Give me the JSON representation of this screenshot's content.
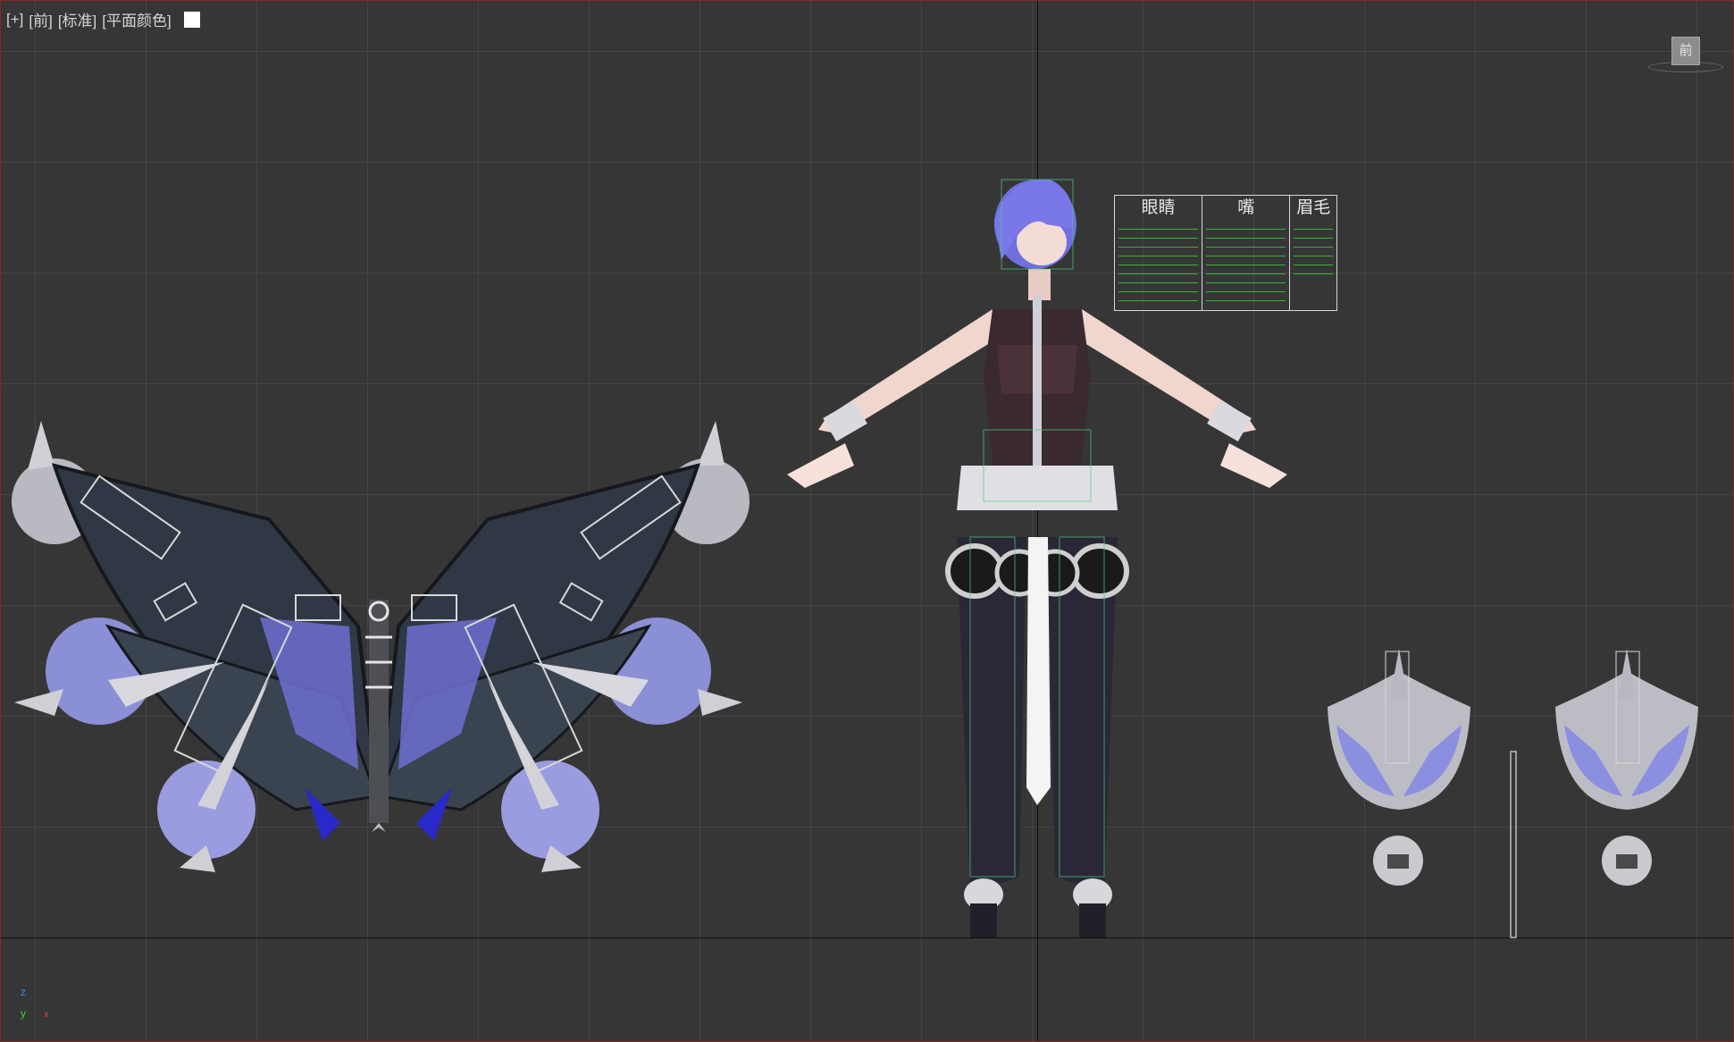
{
  "viewport": {
    "label": {
      "plus": "[+]",
      "view": "[前]",
      "mode": "[标准]",
      "shading": "[平面颜色]"
    },
    "viewcube_face": "前",
    "colors": {
      "background": "#363636",
      "grid": "#454545",
      "border": "#8a2424"
    }
  },
  "control_panel": {
    "sections": [
      "眼睛",
      "嘴",
      "眉毛"
    ]
  },
  "axis_tripod": {
    "z": "z",
    "y": "y",
    "x": "x"
  }
}
